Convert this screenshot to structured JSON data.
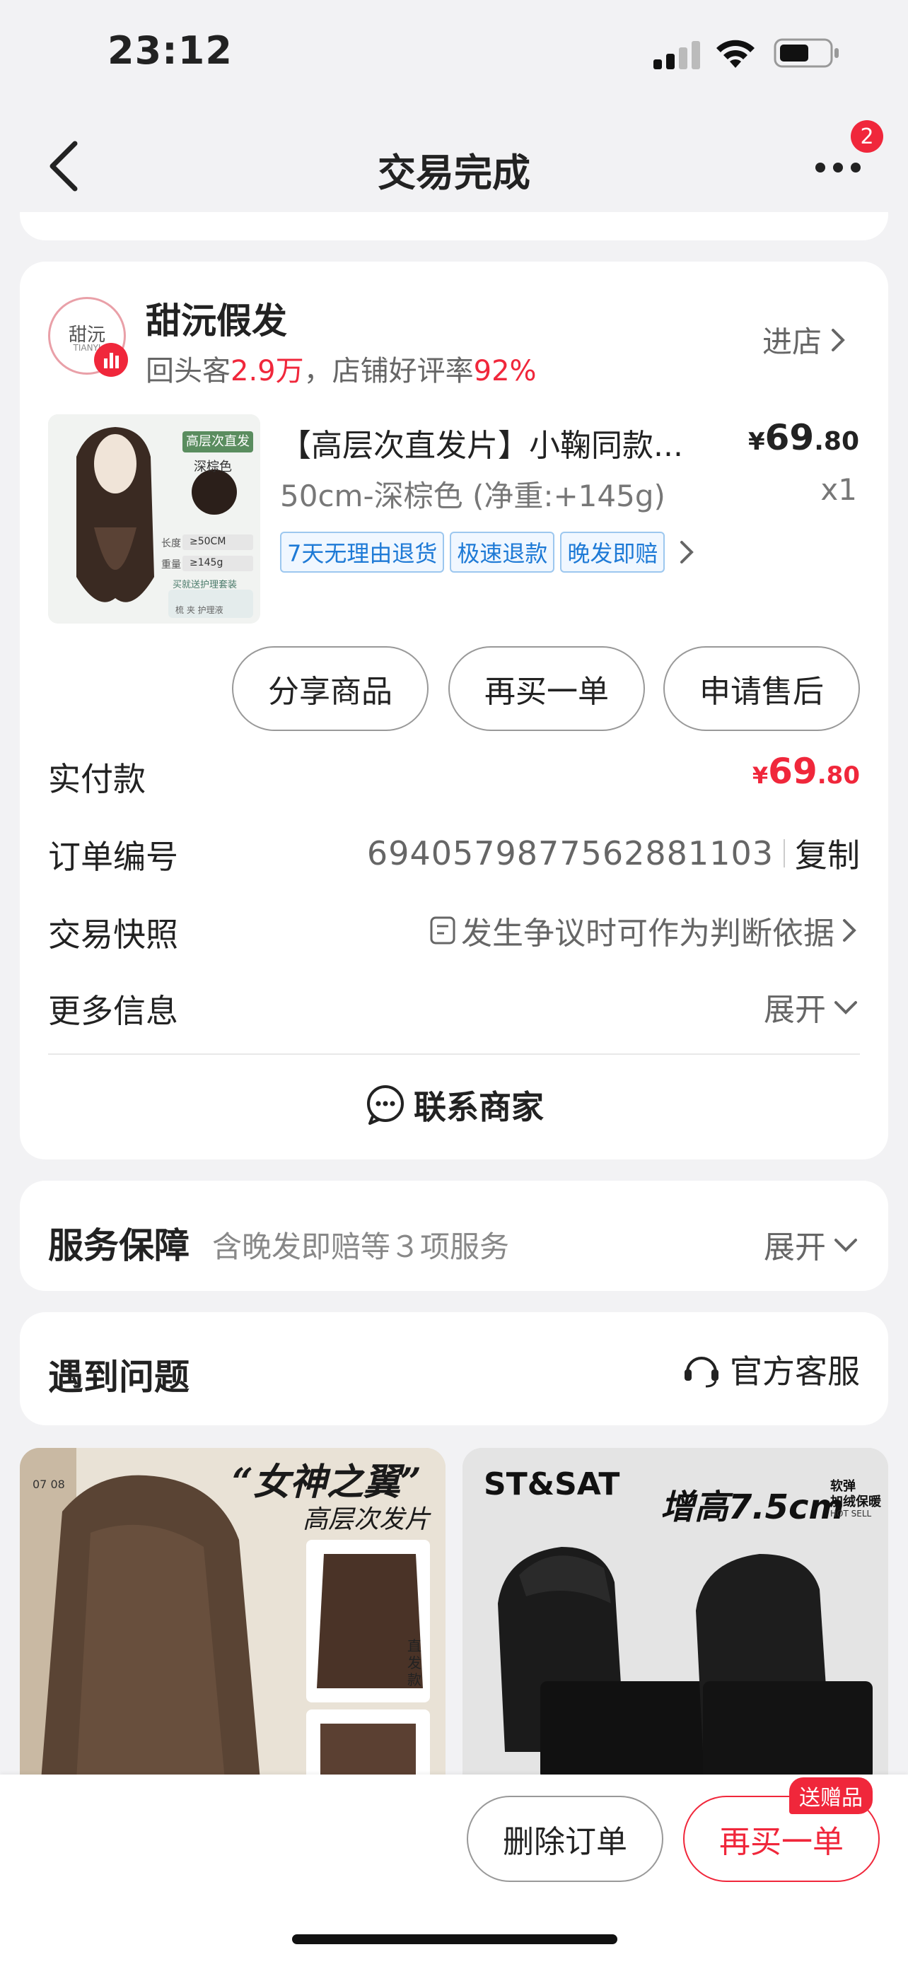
{
  "status_bar": {
    "time": "23:12"
  },
  "nav": {
    "title": "交易完成",
    "badge_count": "2"
  },
  "shop": {
    "logo_text": "甜沅",
    "logo_sub": "TIANYI",
    "name": "甜沅假发",
    "repeat_label": "回头客",
    "repeat_value": "2.9万",
    "separator": "，",
    "rating_label": "店铺好评率",
    "rating_value": "92%",
    "enter_label": "进店"
  },
  "product": {
    "title": "【高层次直发片】小鞠同款...",
    "price_symbol": "¥",
    "price_int": "69",
    "price_dec": ".80",
    "spec": "50cm-深棕色 (净重:+145g)",
    "qty": "x1",
    "tags": [
      "7天无理由退货",
      "极速退款",
      "晚发即赔"
    ],
    "image_text": {
      "badge": "高层次直发",
      "color": "深棕色",
      "len": "长度",
      "len_val": "≥50CM",
      "weight": "重量",
      "weight_val": "≥145g",
      "gift": "买就送护理套装",
      "gift_items": "梳 夹 护理液"
    }
  },
  "actions": {
    "share": "分享商品",
    "rebuy": "再买一单",
    "aftersale": "申请售后"
  },
  "order": {
    "paid_label": "实付款",
    "paid_symbol": "¥",
    "paid_int": "69",
    "paid_dec": ".80",
    "number_label": "订单编号",
    "number_value": "6940579877562881103",
    "copy_label": "复制",
    "snapshot_label": "交易快照",
    "snapshot_value": "发生争议时可作为判断依据",
    "more_label": "更多信息",
    "more_value": "展开",
    "contact_label": "联系商家"
  },
  "service": {
    "title": "服务保障",
    "desc": "含晚发即赔等３项服务",
    "expand": "展开"
  },
  "problem": {
    "title": "遇到问题",
    "support": "官方客服"
  },
  "recommend": [
    {
      "headline": "“女神之翼”",
      "subline": "高层次发片",
      "side": "直发款",
      "tag": "07 08"
    },
    {
      "brand": "ST&SAT",
      "headline": "增高7.5cm",
      "sub1": "软弹",
      "sub2": "加绒保暖",
      "sub3": "HOT SELL"
    }
  ],
  "bottom": {
    "delete": "删除订单",
    "rebuy": "再买一单",
    "gift_badge": "送赠品"
  },
  "colors": {
    "accent": "#f0273b",
    "tag_blue": "#1e7ad6",
    "bg": "#f2f2f4"
  }
}
